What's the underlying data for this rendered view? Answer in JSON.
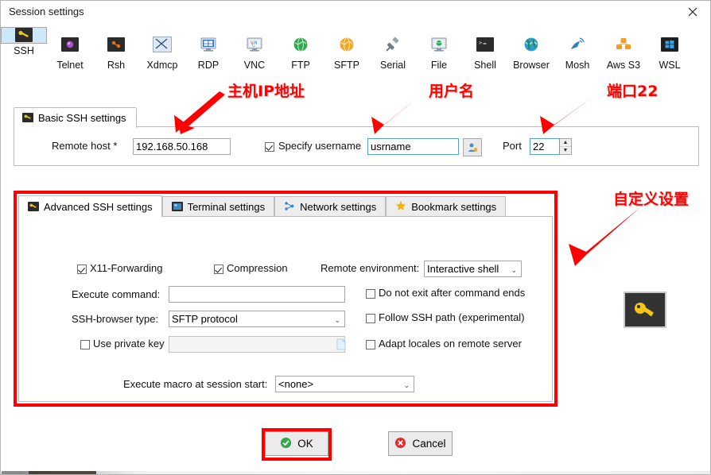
{
  "window": {
    "title": "Session settings",
    "close_icon": "close-icon"
  },
  "protocols": [
    {
      "label": "SSH",
      "icon": "ssh-key-icon",
      "selected": true
    },
    {
      "label": "Telnet",
      "icon": "telnet-icon",
      "selected": false
    },
    {
      "label": "Rsh",
      "icon": "rsh-icon",
      "selected": false
    },
    {
      "label": "Xdmcp",
      "icon": "xdmcp-icon",
      "selected": false
    },
    {
      "label": "RDP",
      "icon": "rdp-monitor-icon",
      "selected": false
    },
    {
      "label": "VNC",
      "icon": "vnc-monitor-icon",
      "selected": false
    },
    {
      "label": "FTP",
      "icon": "ftp-globe-icon",
      "selected": false
    },
    {
      "label": "SFTP",
      "icon": "sftp-globe-icon",
      "selected": false
    },
    {
      "label": "Serial",
      "icon": "serial-plug-icon",
      "selected": false
    },
    {
      "label": "File",
      "icon": "file-monitor-icon",
      "selected": false
    },
    {
      "label": "Shell",
      "icon": "shell-terminal-icon",
      "selected": false
    },
    {
      "label": "Browser",
      "icon": "browser-globe-icon",
      "selected": false
    },
    {
      "label": "Mosh",
      "icon": "mosh-satellite-icon",
      "selected": false
    },
    {
      "label": "Aws S3",
      "icon": "aws-s3-icon",
      "selected": false
    },
    {
      "label": "WSL",
      "icon": "wsl-windows-icon",
      "selected": false
    }
  ],
  "basic": {
    "tab_label": "Basic SSH settings",
    "tab_icon": "ssh-key-icon",
    "remote_host_label": "Remote host *",
    "remote_host_value": "192.168.50.168",
    "specify_username_label": "Specify username",
    "specify_username_checked": true,
    "username_value": "usrname",
    "username_picker_icon": "user-picker-icon",
    "port_label": "Port",
    "port_value": "22",
    "spinner_up_icon": "spinner-up-icon",
    "spinner_down_icon": "spinner-down-icon"
  },
  "advanced": {
    "tabs": [
      {
        "label": "Advanced SSH settings",
        "icon": "ssh-key-icon",
        "active": true
      },
      {
        "label": "Terminal settings",
        "icon": "terminal-icon",
        "active": false
      },
      {
        "label": "Network settings",
        "icon": "network-nodes-icon",
        "active": false
      },
      {
        "label": "Bookmark settings",
        "icon": "star-icon",
        "active": false
      }
    ],
    "x11_label": "X11-Forwarding",
    "x11_checked": true,
    "compression_label": "Compression",
    "compression_checked": true,
    "remote_env_label": "Remote environment:",
    "remote_env_value": "Interactive shell",
    "execute_command_label": "Execute command:",
    "execute_command_value": "",
    "do_not_exit_label": "Do not exit after command ends",
    "do_not_exit_checked": false,
    "ssh_browser_label": "SSH-browser type:",
    "ssh_browser_value": "SFTP protocol",
    "follow_ssh_path_label": "Follow SSH path (experimental)",
    "follow_ssh_path_checked": false,
    "use_private_key_label": "Use private key",
    "use_private_key_checked": false,
    "private_key_value": "",
    "private_key_browse_icon": "file-browse-icon",
    "adapt_locales_label": "Adapt locales on remote server",
    "adapt_locales_checked": false,
    "macro_label": "Execute macro at session start:",
    "macro_value": "<none>",
    "key_image_icon": "big-key-icon"
  },
  "buttons": {
    "ok_label": "OK",
    "ok_icon": "green-check-icon",
    "cancel_label": "Cancel",
    "cancel_icon": "red-cross-icon"
  },
  "annotations": [
    {
      "text": "主机IP地址",
      "name": "annotation-host-ip"
    },
    {
      "text": "用户名",
      "name": "annotation-username"
    },
    {
      "text": "端口22",
      "name": "annotation-port"
    },
    {
      "text": "自定义设置",
      "name": "annotation-custom-settings"
    }
  ],
  "colors": {
    "accent_red": "#ff0000",
    "selected_tile": "#cde8f9",
    "focus_border": "#5a9fd4"
  }
}
